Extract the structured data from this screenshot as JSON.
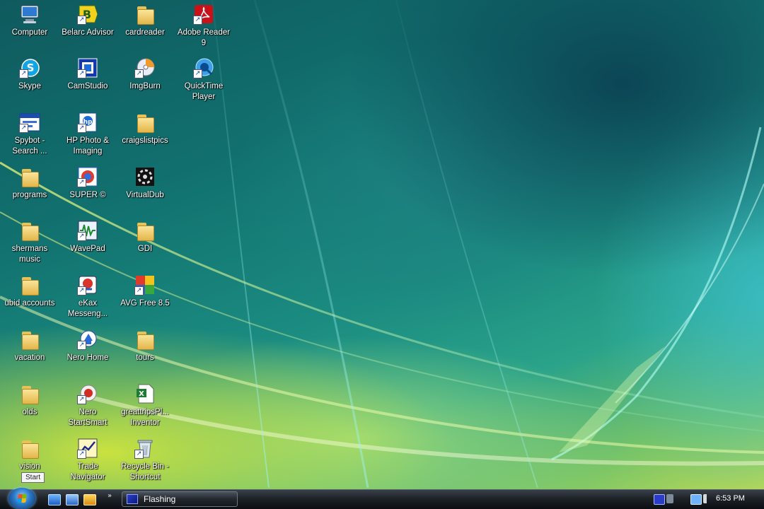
{
  "desktop_icons": [
    {
      "label": "Computer",
      "icon": "computer-icon"
    },
    {
      "label": "Belarc Advisor",
      "icon": "belarc-advisor-icon"
    },
    {
      "label": "cardreader",
      "icon": "folder-icon"
    },
    {
      "label": "Adobe Reader 9",
      "icon": "adobe-reader-icon"
    },
    {
      "label": "Skype",
      "icon": "skype-icon"
    },
    {
      "label": "CamStudio",
      "icon": "camstudio-icon"
    },
    {
      "label": "ImgBurn",
      "icon": "imgburn-icon"
    },
    {
      "label": "QuickTime Player",
      "icon": "quicktime-icon"
    },
    {
      "label": "Spybot - Search ...",
      "icon": "spybot-icon"
    },
    {
      "label": "HP Photo & Imaging",
      "icon": "hp-photo-icon"
    },
    {
      "label": "craigslistpics",
      "icon": "folder-icon"
    },
    {
      "label": "programs",
      "icon": "folder-icon"
    },
    {
      "label": "SUPER ©",
      "icon": "super-icon"
    },
    {
      "label": "VirtualDub",
      "icon": "virtualdub-icon"
    },
    {
      "label": "shermans music",
      "icon": "folder-icon"
    },
    {
      "label": "WavePad",
      "icon": "wavepad-icon"
    },
    {
      "label": "GDI",
      "icon": "folder-icon"
    },
    {
      "label": "ubid accounts",
      "icon": "folder-icon"
    },
    {
      "label": "eKax Messeng...",
      "icon": "messenger-icon"
    },
    {
      "label": "AVG Free 8.5",
      "icon": "avg-icon"
    },
    {
      "label": "vacation",
      "icon": "folder-icon"
    },
    {
      "label": "Nero Home",
      "icon": "nero-home-icon"
    },
    {
      "label": "tours",
      "icon": "folder-icon"
    },
    {
      "label": "olds",
      "icon": "folder-icon"
    },
    {
      "label": "Nero StartSmart",
      "icon": "nero-startsmart-icon"
    },
    {
      "label": "greattripsPl... Inventor",
      "icon": "excel-file-icon"
    },
    {
      "label": "vision",
      "icon": "folder-icon"
    },
    {
      "label": "Trade Navigator",
      "icon": "trade-navigator-icon"
    },
    {
      "label": "Recycle Bin - Shortcut",
      "icon": "recycle-bin-icon"
    }
  ],
  "taskbar": {
    "start_tooltip": "Start",
    "quick_launch": [
      "show-desktop-icon",
      "switch-windows-icon",
      "media-player-icon"
    ],
    "quick_launch_more": "»",
    "task_button_label": "Flashing",
    "tray_icons": [
      "app-tray-icon",
      "network-icon",
      "display-icon",
      "volume-icon"
    ],
    "clock": "6:53 PM"
  },
  "colors": {
    "folder": "#f1cf6f",
    "taskbar": "#1e2329",
    "wallpaper_teal": "#11706e",
    "wallpaper_lime": "#c8dc52"
  }
}
